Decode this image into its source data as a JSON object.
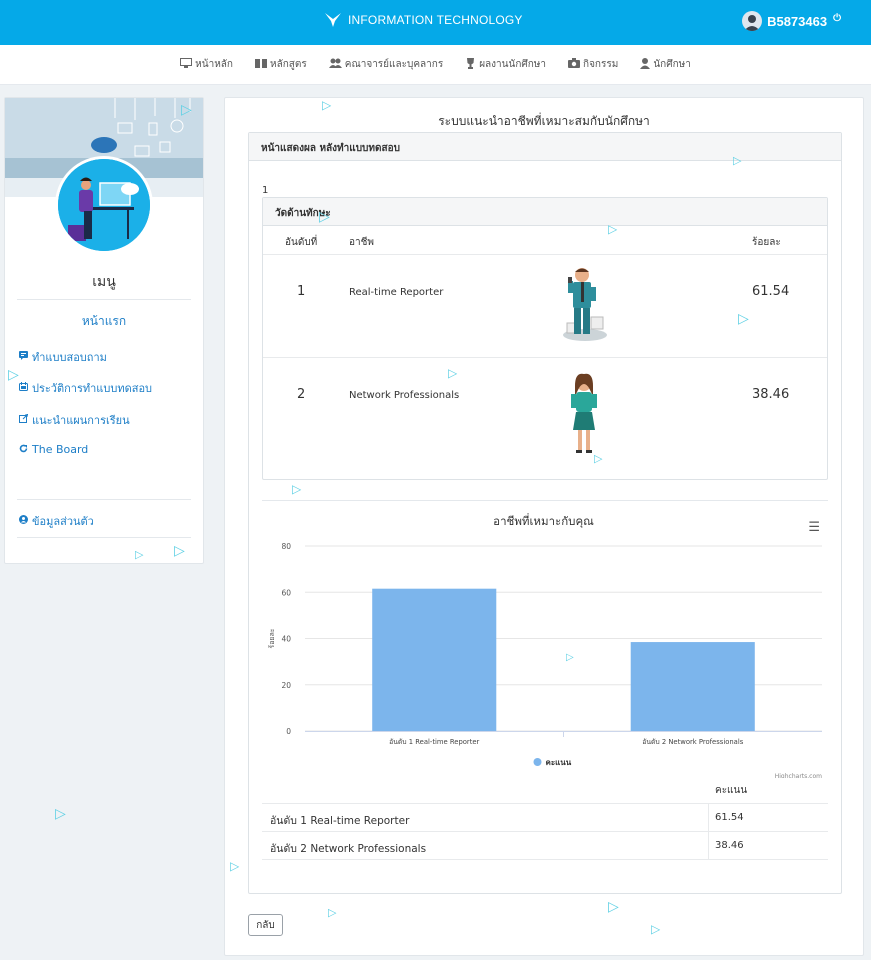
{
  "header": {
    "brand": "INFORMATION TECHNOLOGY",
    "username": "B5873463"
  },
  "nav": [
    {
      "label": "หน้าหลัก",
      "icon": "monitor-icon"
    },
    {
      "label": "หลักสูตร",
      "icon": "book-icon"
    },
    {
      "label": "คณาจารย์และบุคลากร",
      "icon": "users-icon"
    },
    {
      "label": "ผลงานนักศึกษา",
      "icon": "trophy-icon"
    },
    {
      "label": "กิจกรรม",
      "icon": "camera-icon"
    },
    {
      "label": "นักศึกษา",
      "icon": "user-icon"
    }
  ],
  "sidebar": {
    "menu_title": "เมนู",
    "first_page": "หน้าแรก",
    "links": [
      {
        "label": "ทำแบบสอบถาม",
        "icon": "comment-icon"
      },
      {
        "label": "ประวัติการทำแบบทดสอบ",
        "icon": "history-icon"
      },
      {
        "label": "แนะนำแผนการเรียน",
        "icon": "external-link-icon"
      },
      {
        "label": "The Board",
        "icon": "refresh-icon"
      }
    ],
    "profile_link": {
      "label": "ข้อมูลส่วนตัว",
      "icon": "user-circle-icon"
    }
  },
  "main": {
    "title": "ระบบแนะนำอาชีพที่เหมาะสมกับนักศึกษา",
    "card_title": "หน้าแสดงผล หลังทำแบบทดสอบ",
    "number": "1",
    "skill": {
      "title": "วัดด้านทักษะ",
      "headers": {
        "rank": "อันดับที่",
        "job": "อาชีพ",
        "percent": "ร้อยละ"
      },
      "rows": [
        {
          "rank": "1",
          "job": "Real-time Reporter",
          "percent": "61.54"
        },
        {
          "rank": "2",
          "job": "Network Professionals",
          "percent": "38.46"
        }
      ]
    },
    "table": {
      "header": "คะแนน",
      "rows": [
        {
          "category": "อันดับ 1 Real-time Reporter",
          "value": "61.54"
        },
        {
          "category": "อันดับ 2 Network Professionals",
          "value": "38.46"
        }
      ]
    },
    "back_label": "กลับ"
  },
  "chart_data": {
    "type": "bar",
    "title": "อาชีพที่เหมาะกับคุณ",
    "categories": [
      "อันดับ 1 Real-time Reporter",
      "อันดับ 2 Network Professionals"
    ],
    "series": [
      {
        "name": "คะแนน",
        "values": [
          61.54,
          38.46
        ]
      }
    ],
    "ylabel": "ร้อยละ",
    "xlabel": "",
    "ylim": [
      0,
      80
    ],
    "yticks": [
      0,
      20,
      40,
      60,
      80
    ],
    "credit": "Highcharts.com",
    "grid": true,
    "legend": "bottom-center",
    "color": "#7cb5ec"
  }
}
